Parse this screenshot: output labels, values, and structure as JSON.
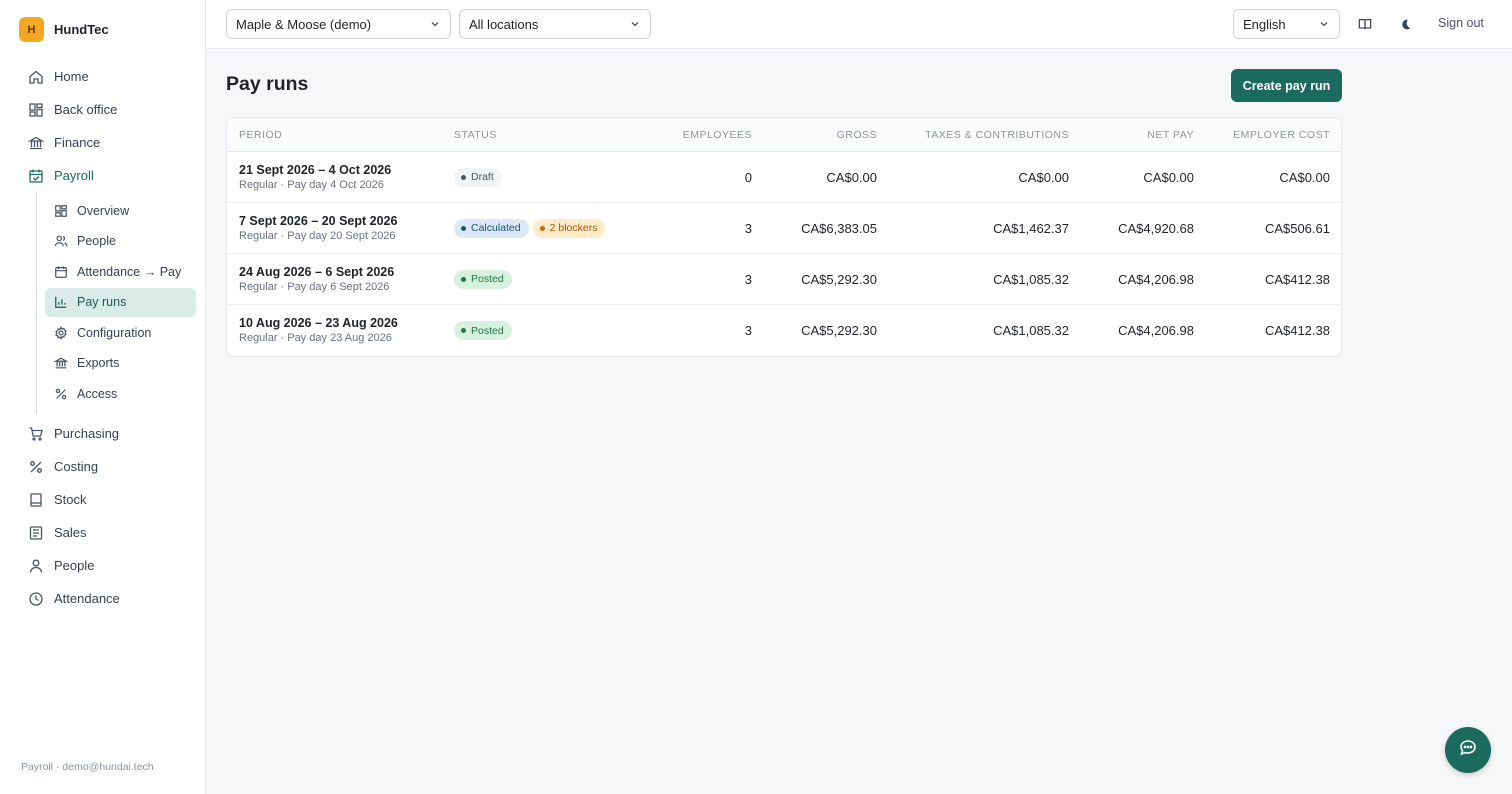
{
  "brand": {
    "logo_letter": "H",
    "name": "HundTec"
  },
  "sidebar": {
    "items": [
      {
        "label": "Home",
        "icon": "home-icon"
      },
      {
        "label": "Back office",
        "icon": "grid-icon"
      },
      {
        "label": "Finance",
        "icon": "bank-icon"
      },
      {
        "label": "Payroll",
        "icon": "calendar-check-icon",
        "active": true
      }
    ],
    "payroll_sub": [
      {
        "label": "Overview",
        "icon": "grid-icon"
      },
      {
        "label": "People",
        "icon": "users-icon"
      },
      {
        "label": "Attendance → Pay",
        "icon": "calendar-icon"
      },
      {
        "label": "Pay runs",
        "icon": "bar-chart-icon",
        "active": true
      },
      {
        "label": "Configuration",
        "icon": "gear-icon"
      },
      {
        "label": "Exports",
        "icon": "bank-icon"
      },
      {
        "label": "Access",
        "icon": "percent-icon"
      }
    ],
    "items_after": [
      {
        "label": "Purchasing",
        "icon": "cart-icon"
      },
      {
        "label": "Costing",
        "icon": "percent-icon"
      },
      {
        "label": "Stock",
        "icon": "box-icon"
      },
      {
        "label": "Sales",
        "icon": "receipt-icon"
      },
      {
        "label": "People",
        "icon": "user-icon"
      },
      {
        "label": "Attendance",
        "icon": "clock-icon"
      }
    ],
    "footer": "Payroll · demo@hundai.tech"
  },
  "topbar": {
    "company": "Maple & Moose (demo)",
    "location": "All locations",
    "language": "English",
    "sign_out": "Sign out"
  },
  "page": {
    "title": "Pay runs",
    "create_button": "Create pay run"
  },
  "table": {
    "headers": {
      "period": "PERIOD",
      "status": "STATUS",
      "employees": "EMPLOYEES",
      "gross": "GROSS",
      "taxes": "TAXES & CONTRIBUTIONS",
      "net": "NET PAY",
      "employer_cost": "EMPLOYER COST"
    },
    "rows": [
      {
        "period": "21 Sept 2026 – 4 Oct 2026",
        "sub": "Regular · Pay day 4 Oct 2026",
        "badges": [
          {
            "label": "Draft",
            "kind": "draft"
          }
        ],
        "employees": "0",
        "gross": "CA$0.00",
        "taxes": "CA$0.00",
        "net": "CA$0.00",
        "employer_cost": "CA$0.00"
      },
      {
        "period": "7 Sept 2026 – 20 Sept 2026",
        "sub": "Regular · Pay day 20 Sept 2026",
        "badges": [
          {
            "label": "Calculated",
            "kind": "calc"
          },
          {
            "label": "2 blockers",
            "kind": "warn"
          }
        ],
        "employees": "3",
        "gross": "CA$6,383.05",
        "taxes": "CA$1,462.37",
        "net": "CA$4,920.68",
        "employer_cost": "CA$506.61"
      },
      {
        "period": "24 Aug 2026 – 6 Sept 2026",
        "sub": "Regular · Pay day 6 Sept 2026",
        "badges": [
          {
            "label": "Posted",
            "kind": "posted"
          }
        ],
        "employees": "3",
        "gross": "CA$5,292.30",
        "taxes": "CA$1,085.32",
        "net": "CA$4,206.98",
        "employer_cost": "CA$412.38"
      },
      {
        "period": "10 Aug 2026 – 23 Aug 2026",
        "sub": "Regular · Pay day 23 Aug 2026",
        "badges": [
          {
            "label": "Posted",
            "kind": "posted"
          }
        ],
        "employees": "3",
        "gross": "CA$5,292.30",
        "taxes": "CA$1,085.32",
        "net": "CA$4,206.98",
        "employer_cost": "CA$412.38"
      }
    ]
  },
  "colors": {
    "accent": "#1a6b5e",
    "brand_logo": "#f5a623"
  }
}
